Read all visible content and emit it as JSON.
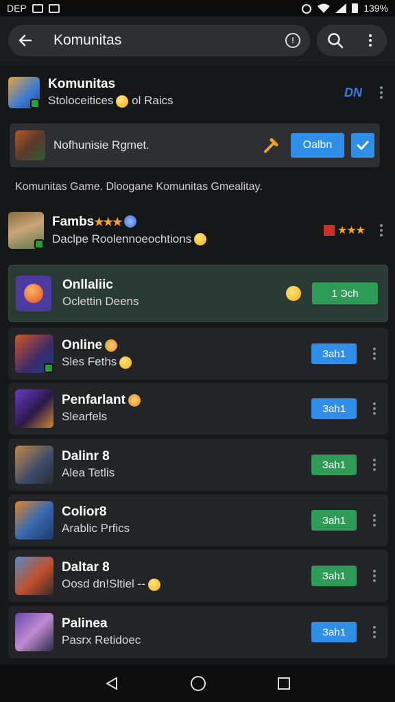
{
  "status_bar": {
    "left_text": "DEP",
    "battery": "139%"
  },
  "search": {
    "value": "Komunitas"
  },
  "header_app": {
    "title": "Komunitas",
    "subtitle": "Stoloceitices",
    "subtitle_tail": "ol Raics",
    "badge": "DN"
  },
  "promo": {
    "text": "Nofhunisie Rgmet.",
    "button_label": "Oalbn"
  },
  "caption": "Komunitas Game. Dlooganе Komunitas Gmealitay.",
  "featured": {
    "title": "Fambs",
    "subtitle": "Daclpe Roolennoeochtions"
  },
  "highlighted": {
    "title": "Onllaliic",
    "subtitle": "Oclettin Deens",
    "button_label": "1 Эch"
  },
  "games": [
    {
      "title": "Online",
      "subtitle": "Sles Feths",
      "button_label": "Заh1",
      "button_color": "#2f8fe8"
    },
    {
      "title": "Penfarlant",
      "subtitle": "Slearfels",
      "button_label": "Заh1",
      "button_color": "#2f8fe8"
    },
    {
      "title": "Dalinr 8",
      "subtitle": "Alea Tetlis",
      "button_label": "Заh1",
      "button_color": "#2e9b56"
    },
    {
      "title": "Colior8",
      "subtitle": "Arablic Prfics",
      "button_label": "Заh1",
      "button_color": "#2e9b56"
    },
    {
      "title": "Daltar 8",
      "subtitle": "Oosd dn!Sltiel --",
      "button_label": "Заh1",
      "button_color": "#2e9b56"
    },
    {
      "title": "Palinea",
      "subtitle": "Pasrx Retidoec",
      "button_label": "Заh1",
      "button_color": "#2f8fe8"
    }
  ],
  "colors": {
    "accent_blue": "#2f8fe8",
    "accent_green": "#2e9b56",
    "highlight_bg": "#2a3a34"
  }
}
